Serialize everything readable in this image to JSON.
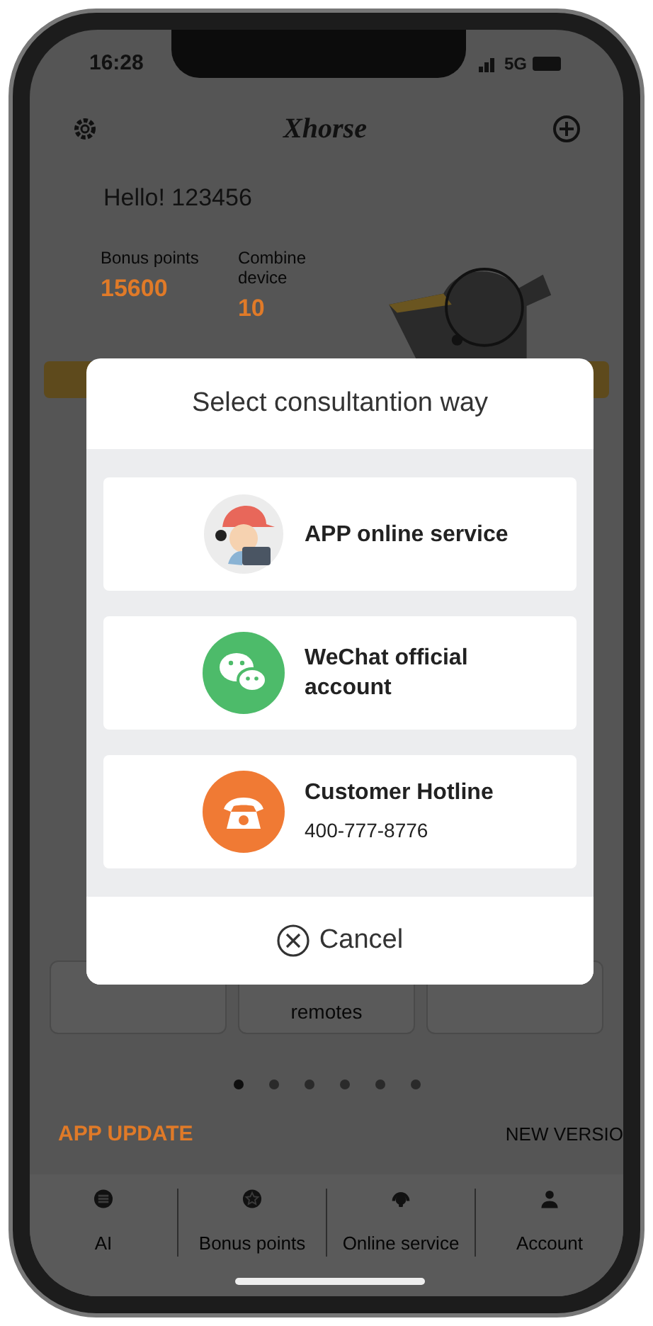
{
  "status_bar": {
    "time": "16:28",
    "network": "5G"
  },
  "header": {
    "logo": "Xhorse"
  },
  "greeting": "Hello! 123456",
  "stats": [
    {
      "label": "Bonus points",
      "value": "15600"
    },
    {
      "label": "Combine device",
      "value": "10"
    }
  ],
  "feature_cards": [
    {
      "kind": "covered"
    },
    {
      "kind": "text",
      "label": "remotes"
    },
    {
      "kind": "covered"
    }
  ],
  "page_dots": [
    {
      "selected": true
    },
    {
      "selected": false
    },
    {
      "selected": false
    },
    {
      "selected": false
    },
    {
      "selected": false
    },
    {
      "selected": false
    }
  ],
  "update": {
    "title": "APP UPDATE",
    "action": "NEW VERSIO"
  },
  "tabs": [
    {
      "kind": "ai",
      "label": "AI"
    },
    {
      "kind": "star",
      "label": "Bonus points"
    },
    {
      "kind": "service",
      "label": "Online service"
    },
    {
      "kind": "account",
      "label": "Account"
    }
  ],
  "dialog": {
    "title": "Select consultantion way",
    "options": [
      {
        "kind": "avatar",
        "title": "APP online service"
      },
      {
        "kind": "wechat",
        "title": "WeChat official account"
      },
      {
        "kind": "phone",
        "title": "Customer Hotline",
        "subtitle": "400-777-8776"
      }
    ],
    "cancel": "Cancel"
  }
}
